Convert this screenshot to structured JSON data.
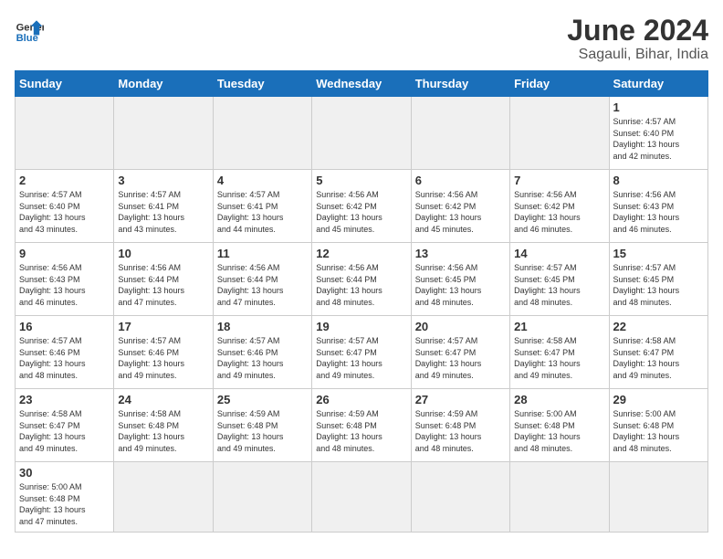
{
  "header": {
    "logo_general": "General",
    "logo_blue": "Blue",
    "title": "June 2024",
    "subtitle": "Sagauli, Bihar, India"
  },
  "weekdays": [
    "Sunday",
    "Monday",
    "Tuesday",
    "Wednesday",
    "Thursday",
    "Friday",
    "Saturday"
  ],
  "weeks": [
    [
      {
        "day": "",
        "info": "",
        "empty": true
      },
      {
        "day": "",
        "info": "",
        "empty": true
      },
      {
        "day": "",
        "info": "",
        "empty": true
      },
      {
        "day": "",
        "info": "",
        "empty": true
      },
      {
        "day": "",
        "info": "",
        "empty": true
      },
      {
        "day": "",
        "info": "",
        "empty": true
      },
      {
        "day": "1",
        "info": "Sunrise: 4:57 AM\nSunset: 6:40 PM\nDaylight: 13 hours\nand 42 minutes.",
        "empty": false
      }
    ],
    [
      {
        "day": "2",
        "info": "Sunrise: 4:57 AM\nSunset: 6:40 PM\nDaylight: 13 hours\nand 43 minutes.",
        "empty": false
      },
      {
        "day": "3",
        "info": "Sunrise: 4:57 AM\nSunset: 6:41 PM\nDaylight: 13 hours\nand 43 minutes.",
        "empty": false
      },
      {
        "day": "4",
        "info": "Sunrise: 4:57 AM\nSunset: 6:41 PM\nDaylight: 13 hours\nand 44 minutes.",
        "empty": false
      },
      {
        "day": "5",
        "info": "Sunrise: 4:56 AM\nSunset: 6:42 PM\nDaylight: 13 hours\nand 45 minutes.",
        "empty": false
      },
      {
        "day": "6",
        "info": "Sunrise: 4:56 AM\nSunset: 6:42 PM\nDaylight: 13 hours\nand 45 minutes.",
        "empty": false
      },
      {
        "day": "7",
        "info": "Sunrise: 4:56 AM\nSunset: 6:42 PM\nDaylight: 13 hours\nand 46 minutes.",
        "empty": false
      },
      {
        "day": "8",
        "info": "Sunrise: 4:56 AM\nSunset: 6:43 PM\nDaylight: 13 hours\nand 46 minutes.",
        "empty": false
      }
    ],
    [
      {
        "day": "9",
        "info": "Sunrise: 4:56 AM\nSunset: 6:43 PM\nDaylight: 13 hours\nand 46 minutes.",
        "empty": false
      },
      {
        "day": "10",
        "info": "Sunrise: 4:56 AM\nSunset: 6:44 PM\nDaylight: 13 hours\nand 47 minutes.",
        "empty": false
      },
      {
        "day": "11",
        "info": "Sunrise: 4:56 AM\nSunset: 6:44 PM\nDaylight: 13 hours\nand 47 minutes.",
        "empty": false
      },
      {
        "day": "12",
        "info": "Sunrise: 4:56 AM\nSunset: 6:44 PM\nDaylight: 13 hours\nand 48 minutes.",
        "empty": false
      },
      {
        "day": "13",
        "info": "Sunrise: 4:56 AM\nSunset: 6:45 PM\nDaylight: 13 hours\nand 48 minutes.",
        "empty": false
      },
      {
        "day": "14",
        "info": "Sunrise: 4:57 AM\nSunset: 6:45 PM\nDaylight: 13 hours\nand 48 minutes.",
        "empty": false
      },
      {
        "day": "15",
        "info": "Sunrise: 4:57 AM\nSunset: 6:45 PM\nDaylight: 13 hours\nand 48 minutes.",
        "empty": false
      }
    ],
    [
      {
        "day": "16",
        "info": "Sunrise: 4:57 AM\nSunset: 6:46 PM\nDaylight: 13 hours\nand 48 minutes.",
        "empty": false
      },
      {
        "day": "17",
        "info": "Sunrise: 4:57 AM\nSunset: 6:46 PM\nDaylight: 13 hours\nand 49 minutes.",
        "empty": false
      },
      {
        "day": "18",
        "info": "Sunrise: 4:57 AM\nSunset: 6:46 PM\nDaylight: 13 hours\nand 49 minutes.",
        "empty": false
      },
      {
        "day": "19",
        "info": "Sunrise: 4:57 AM\nSunset: 6:47 PM\nDaylight: 13 hours\nand 49 minutes.",
        "empty": false
      },
      {
        "day": "20",
        "info": "Sunrise: 4:57 AM\nSunset: 6:47 PM\nDaylight: 13 hours\nand 49 minutes.",
        "empty": false
      },
      {
        "day": "21",
        "info": "Sunrise: 4:58 AM\nSunset: 6:47 PM\nDaylight: 13 hours\nand 49 minutes.",
        "empty": false
      },
      {
        "day": "22",
        "info": "Sunrise: 4:58 AM\nSunset: 6:47 PM\nDaylight: 13 hours\nand 49 minutes.",
        "empty": false
      }
    ],
    [
      {
        "day": "23",
        "info": "Sunrise: 4:58 AM\nSunset: 6:47 PM\nDaylight: 13 hours\nand 49 minutes.",
        "empty": false
      },
      {
        "day": "24",
        "info": "Sunrise: 4:58 AM\nSunset: 6:48 PM\nDaylight: 13 hours\nand 49 minutes.",
        "empty": false
      },
      {
        "day": "25",
        "info": "Sunrise: 4:59 AM\nSunset: 6:48 PM\nDaylight: 13 hours\nand 49 minutes.",
        "empty": false
      },
      {
        "day": "26",
        "info": "Sunrise: 4:59 AM\nSunset: 6:48 PM\nDaylight: 13 hours\nand 48 minutes.",
        "empty": false
      },
      {
        "day": "27",
        "info": "Sunrise: 4:59 AM\nSunset: 6:48 PM\nDaylight: 13 hours\nand 48 minutes.",
        "empty": false
      },
      {
        "day": "28",
        "info": "Sunrise: 5:00 AM\nSunset: 6:48 PM\nDaylight: 13 hours\nand 48 minutes.",
        "empty": false
      },
      {
        "day": "29",
        "info": "Sunrise: 5:00 AM\nSunset: 6:48 PM\nDaylight: 13 hours\nand 48 minutes.",
        "empty": false
      }
    ],
    [
      {
        "day": "30",
        "info": "Sunrise: 5:00 AM\nSunset: 6:48 PM\nDaylight: 13 hours\nand 47 minutes.",
        "empty": false
      },
      {
        "day": "",
        "info": "",
        "empty": true
      },
      {
        "day": "",
        "info": "",
        "empty": true
      },
      {
        "day": "",
        "info": "",
        "empty": true
      },
      {
        "day": "",
        "info": "",
        "empty": true
      },
      {
        "day": "",
        "info": "",
        "empty": true
      },
      {
        "day": "",
        "info": "",
        "empty": true
      }
    ]
  ]
}
